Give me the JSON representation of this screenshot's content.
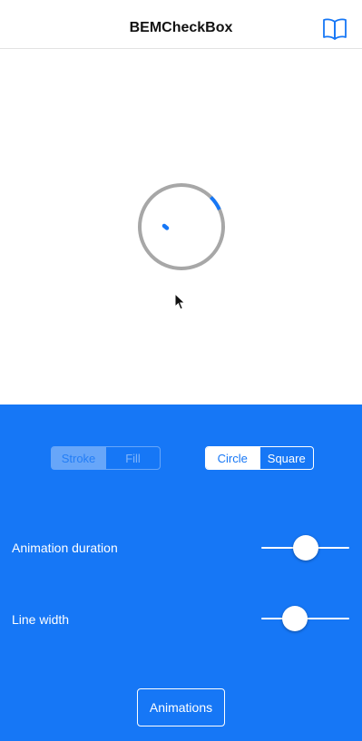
{
  "header": {
    "title": "BEMCheckBox",
    "book_icon": "book-open-icon"
  },
  "checkbox": {
    "state": "animating",
    "stroke_color": "#a7a7a7",
    "tint_color": "#1677f6"
  },
  "panel": {
    "background": "#1677f6",
    "fill_mode": {
      "options": [
        "Stroke",
        "Fill"
      ],
      "selected": "Stroke",
      "enabled": false
    },
    "shape": {
      "options": [
        "Circle",
        "Square"
      ],
      "selected": "Circle"
    },
    "animation_duration": {
      "label": "Animation duration",
      "value": 0.5
    },
    "line_width": {
      "label": "Line width",
      "value": 0.38
    },
    "animations_button": "Animations"
  }
}
